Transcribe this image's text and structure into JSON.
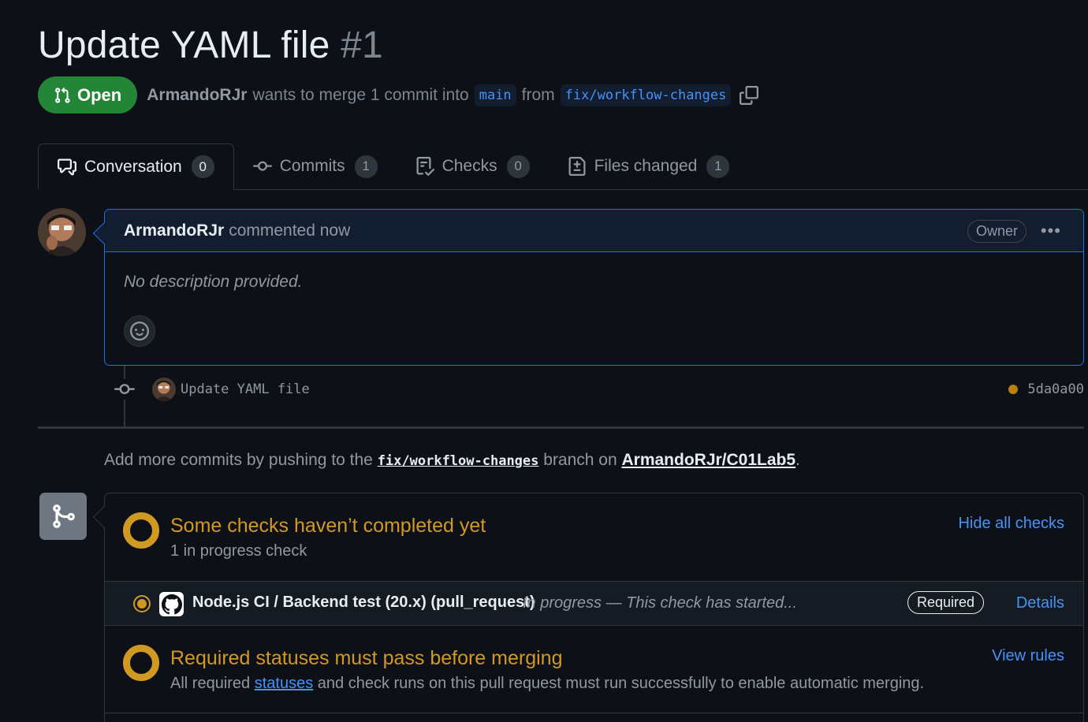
{
  "pr": {
    "title": "Update YAML file",
    "number": "#1",
    "state": "Open",
    "author": "ArmandoRJr",
    "merge_text": "wants to merge 1 commit into",
    "base_branch": "main",
    "from_text": "from",
    "head_branch": "fix/workflow-changes"
  },
  "tabs": [
    {
      "label": "Conversation",
      "count": "0",
      "icon": "comment-discussion-icon"
    },
    {
      "label": "Commits",
      "count": "1",
      "icon": "git-commit-icon"
    },
    {
      "label": "Checks",
      "count": "0",
      "icon": "checklist-icon"
    },
    {
      "label": "Files changed",
      "count": "1",
      "icon": "file-diff-icon"
    }
  ],
  "comment": {
    "author": "ArmandoRJr",
    "action": "commented now",
    "role_badge": "Owner",
    "body": "No description provided."
  },
  "commit": {
    "message": "Update YAML file",
    "sha": "5da0a00",
    "status_color": "#bb8009"
  },
  "push_hint": {
    "prefix": "Add more commits by pushing to the",
    "branch": "fix/workflow-changes",
    "middle": "branch on",
    "repo": "ArmandoRJr/C01Lab5",
    "suffix": "."
  },
  "checks": {
    "title": "Some checks haven’t completed yet",
    "subtitle": "1 in progress check",
    "toggle_link": "Hide all checks",
    "items": [
      {
        "name": "Node.js CI / Backend test (20.x) (pull_request)",
        "status": "In progress — This check has started...",
        "badge": "Required",
        "link": "Details"
      }
    ]
  },
  "required_statuses": {
    "title": "Required statuses must pass before merging",
    "desc_prefix": "All required",
    "desc_link": "statuses",
    "desc_suffix": "and check runs on this pull request must run successfully to enable automatic merging.",
    "link": "View rules"
  },
  "colors": {
    "open_green": "#238636",
    "pending_yellow": "#d29922",
    "link_blue": "#4493f8",
    "comment_border": "#1f6feb"
  }
}
